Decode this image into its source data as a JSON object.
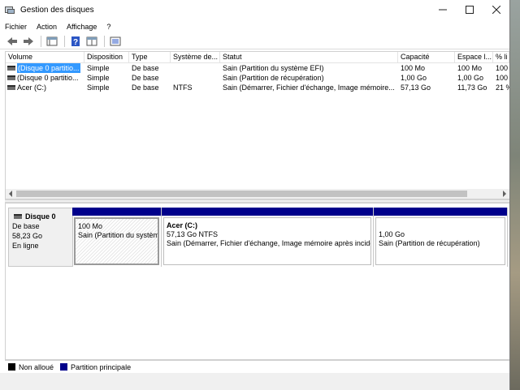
{
  "window": {
    "title": "Gestion des disques",
    "minimize_glyph": "—",
    "maximize_glyph": "☐",
    "close_glyph": "✕"
  },
  "menu": {
    "items": [
      "Fichier",
      "Action",
      "Affichage",
      "?"
    ]
  },
  "toolbar": {
    "buttons": [
      "back-icon",
      "forward-icon",
      "console-icon",
      "help-icon",
      "properties-icon",
      "view-icon"
    ]
  },
  "list": {
    "columns": [
      "Volume",
      "Disposition",
      "Type",
      "Système de...",
      "Statut",
      "Capacité",
      "Espace l...",
      "% li"
    ],
    "rows": [
      {
        "volume": "(Disque 0 partitio...",
        "disposition": "Simple",
        "type": "De base",
        "fs": "",
        "status": "Sain (Partition du système EFI)",
        "capacity": "100 Mo",
        "free": "100 Mo",
        "pct": "100",
        "selected": true
      },
      {
        "volume": "(Disque 0 partitio...",
        "disposition": "Simple",
        "type": "De base",
        "fs": "",
        "status": "Sain (Partition de récupération)",
        "capacity": "1,00 Go",
        "free": "1,00 Go",
        "pct": "100",
        "selected": false
      },
      {
        "volume": "Acer (C:)",
        "disposition": "Simple",
        "type": "De base",
        "fs": "NTFS",
        "status": "Sain (Démarrer, Fichier d'échange, Image mémoire...",
        "capacity": "57,13 Go",
        "free": "11,73 Go",
        "pct": "21 %",
        "selected": false
      }
    ]
  },
  "disk": {
    "name": "Disque 0",
    "type": "De base",
    "size": "58,23 Go",
    "state": "En ligne",
    "partitions": [
      {
        "name": "",
        "size": "100 Mo",
        "status": "Sain (Partition du systèm",
        "hatched": true
      },
      {
        "name": "Acer  (C:)",
        "size": "57,13 Go NTFS",
        "status": "Sain (Démarrer, Fichier d'échange, Image mémoire après incider",
        "hatched": false
      },
      {
        "name": "",
        "size": "1,00 Go",
        "status": "Sain (Partition de récupération)",
        "hatched": false
      }
    ]
  },
  "legend": {
    "items": [
      {
        "label": "Non alloué",
        "color": "#000000"
      },
      {
        "label": "Partition principale",
        "color": "#00008b"
      }
    ]
  }
}
